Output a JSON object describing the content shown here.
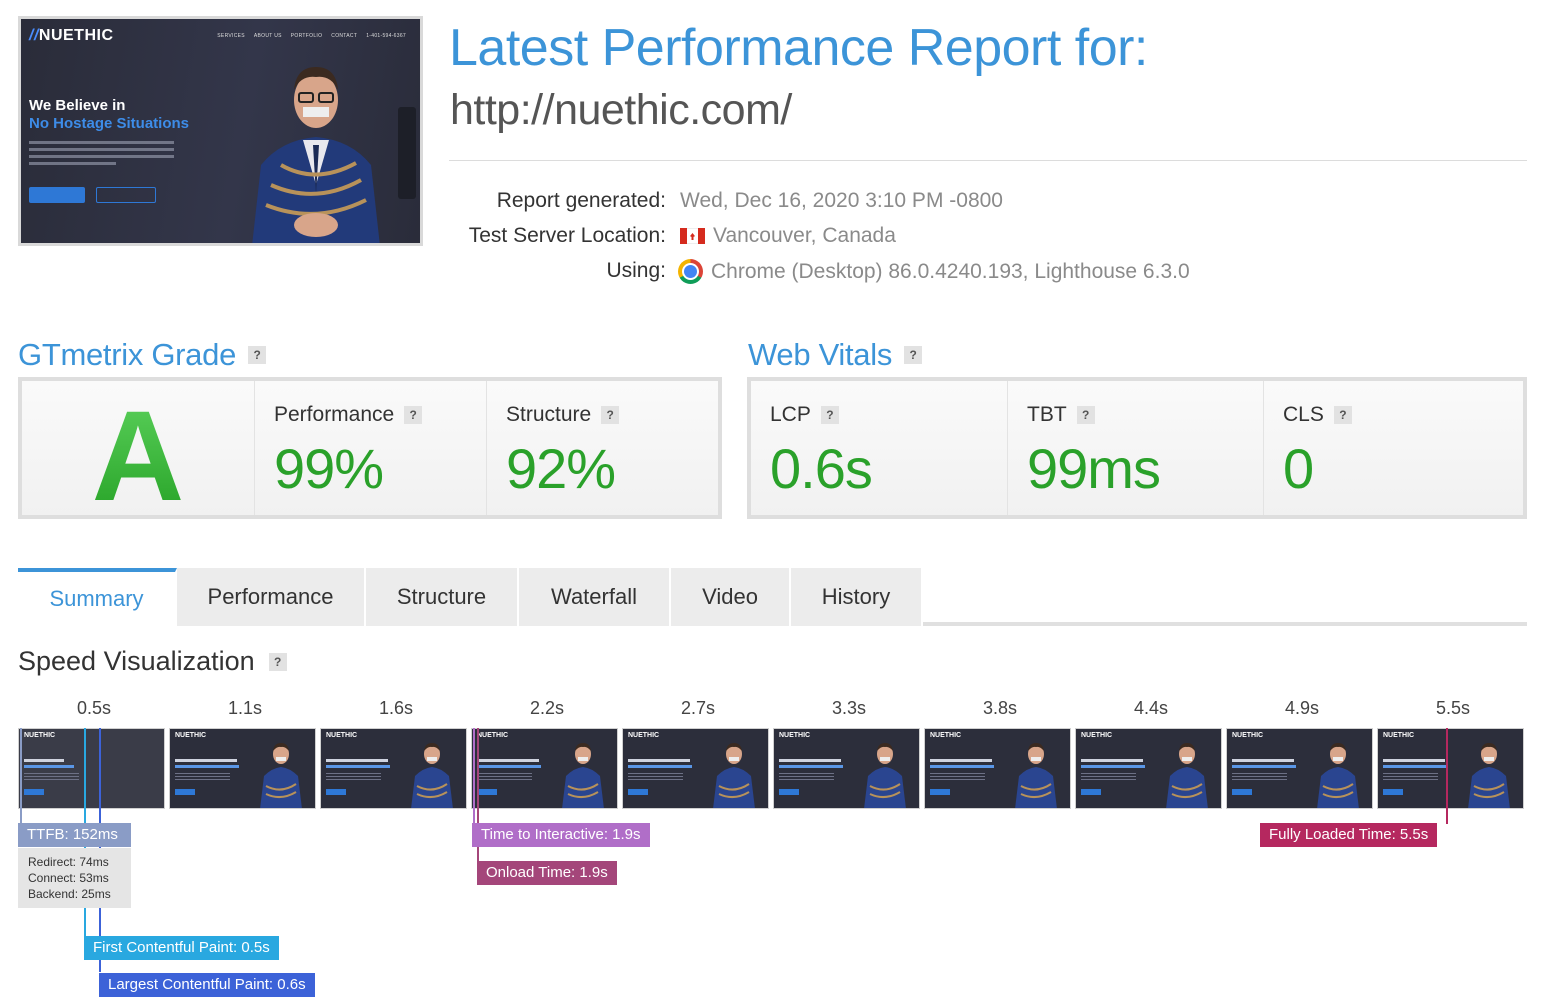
{
  "thumbnail": {
    "logo_slash": "//",
    "logo_text": "NUETHIC",
    "nav": [
      "SERVICES",
      "ABOUT US",
      "PORTFOLIO",
      "CONTACT",
      "1-401-594-6367"
    ],
    "headline_line1": "We Believe in",
    "headline_line2": "No Hostage Situations"
  },
  "header": {
    "title": "Latest Performance Report for:",
    "url": "http://nuethic.com/"
  },
  "meta": {
    "report_generated_label": "Report generated:",
    "report_generated_value": "Wed, Dec 16, 2020 3:10 PM -0800",
    "server_label": "Test Server Location:",
    "server_value": "Vancouver, Canada",
    "using_label": "Using:",
    "using_value": "Chrome (Desktop) 86.0.4240.193, Lighthouse 6.3.0"
  },
  "gtmetrix": {
    "title": "GTmetrix Grade",
    "help": "?",
    "grade": "A",
    "performance_label": "Performance",
    "performance_value": "99%",
    "structure_label": "Structure",
    "structure_value": "92%"
  },
  "web_vitals": {
    "title": "Web Vitals",
    "help": "?",
    "lcp_label": "LCP",
    "lcp_value": "0.6s",
    "tbt_label": "TBT",
    "tbt_value": "99ms",
    "cls_label": "CLS",
    "cls_value": "0"
  },
  "tabs": [
    "Summary",
    "Performance",
    "Structure",
    "Waterfall",
    "Video",
    "History"
  ],
  "active_tab": "Summary",
  "speed_viz": {
    "title": "Speed Visualization",
    "help": "?",
    "ticks": [
      "0.5s",
      "1.1s",
      "1.6s",
      "2.2s",
      "2.7s",
      "3.3s",
      "3.8s",
      "4.4s",
      "4.9s",
      "5.5s"
    ],
    "frame_logo": "NUETHIC",
    "ttfb": "TTFB: 152ms",
    "redirect": "Redirect: 74ms",
    "connect": "Connect: 53ms",
    "backend": "Backend: 25ms",
    "tti": "Time to Interactive: 1.9s",
    "onload": "Onload Time: 1.9s",
    "fully_loaded": "Fully Loaded Time: 5.5s",
    "fcp": "First Contentful Paint: 0.5s",
    "lcp": "Largest Contentful Paint: 0.6s"
  },
  "colors": {
    "accent": "#3c94d8",
    "good": "#2aa12a",
    "ttfb": "#8a9cc6",
    "tti": "#b06ec8",
    "onload": "#a4467a",
    "fully_loaded": "#b5285f",
    "fcp": "#29a8e0",
    "lcp": "#3c62d8"
  }
}
